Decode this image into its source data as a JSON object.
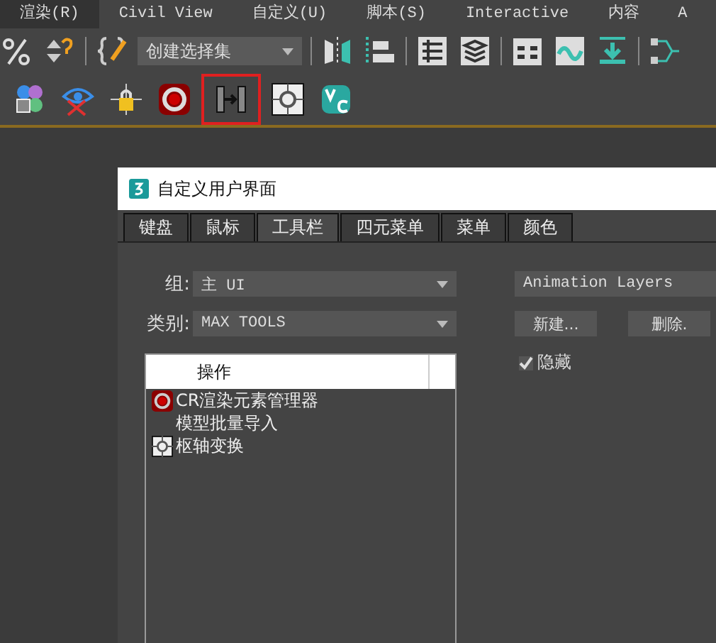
{
  "menu_bar": [
    {
      "label": "渲染(R)",
      "selected": true
    },
    {
      "label": "Civil View",
      "selected": false
    },
    {
      "label": "自定义(U)",
      "selected": false
    },
    {
      "label": "脚本(S)",
      "selected": false
    },
    {
      "label": "Interactive",
      "selected": false
    },
    {
      "label": "内容",
      "selected": false
    },
    {
      "label": "A",
      "selected": false
    }
  ],
  "toolbar": {
    "selection_set": {
      "value": "创建选择集"
    },
    "tools": [
      {
        "kind": "materials",
        "highlighted": false
      },
      {
        "kind": "hide",
        "highlighted": false
      },
      {
        "kind": "lock",
        "highlighted": false
      },
      {
        "kind": "render",
        "highlighted": false
      },
      {
        "kind": "import",
        "highlighted": true
      },
      {
        "kind": "pivot",
        "highlighted": false
      },
      {
        "kind": "vc",
        "highlighted": false
      }
    ]
  },
  "dialog": {
    "title": "自定义用户界面",
    "tabs": [
      {
        "label": "键盘",
        "selected": false
      },
      {
        "label": "鼠标",
        "selected": false
      },
      {
        "label": "工具栏",
        "selected": true
      },
      {
        "label": "四元菜单",
        "selected": false
      },
      {
        "label": "菜单",
        "selected": false
      },
      {
        "label": "颜色",
        "selected": false
      }
    ],
    "group": {
      "label": "组:",
      "value": "主 UI"
    },
    "category": {
      "label": "类别:",
      "value": "MAX TOOLS"
    },
    "actions": {
      "header": "操作",
      "rows": [
        {
          "kind": "render",
          "label": "CR渲染元素管理器"
        },
        {
          "kind": "blank",
          "label": "模型批量导入"
        },
        {
          "kind": "pivot",
          "label": "枢轴变换"
        }
      ]
    },
    "toolbar_select": {
      "value": "Animation Layers"
    },
    "buttons": [
      "新建...",
      "删除."
    ],
    "hidden": {
      "label": "隐藏",
      "checked": true
    }
  }
}
